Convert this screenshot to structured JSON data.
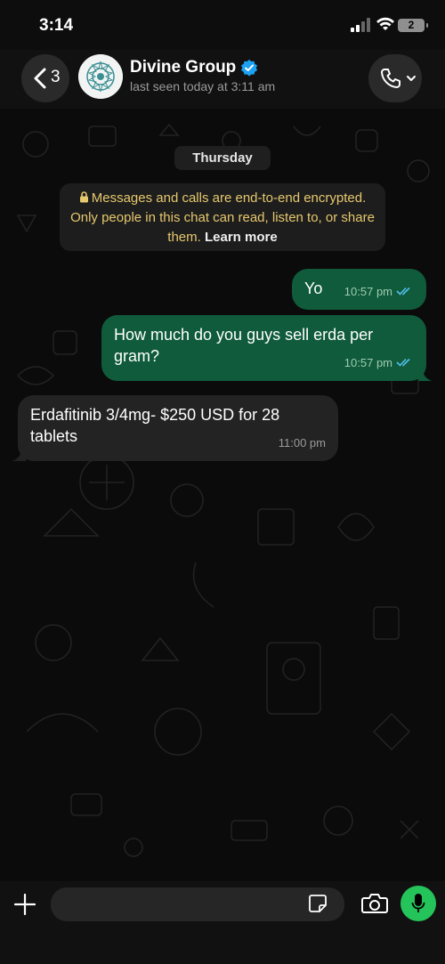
{
  "status_bar": {
    "time": "3:14",
    "battery_level": "2"
  },
  "header": {
    "back_count": "3",
    "contact_name": "Divine Group",
    "last_seen": "last seen today at 3:11 am"
  },
  "chat": {
    "day_label": "Thursday",
    "encryption_notice": "Messages and calls are end-to-end encrypted. Only people in this chat can read, listen to, or share them.",
    "learn_more": "Learn more",
    "messages": [
      {
        "direction": "outgoing",
        "text": "Yo",
        "time": "10:57 pm",
        "status": "read"
      },
      {
        "direction": "outgoing",
        "text": "How much do you guys sell erda per gram?",
        "time": "10:57 pm",
        "status": "read"
      },
      {
        "direction": "incoming",
        "text": "Erdafitinib 3/4mg- $250 USD for 28 tablets",
        "time": "11:00 pm"
      }
    ]
  },
  "composer": {
    "input_value": "",
    "input_placeholder": ""
  },
  "colors": {
    "outgoing_bubble": "#0f5b3b",
    "incoming_bubble": "#232323",
    "read_ticks": "#53bdeb",
    "mic_button": "#25c45a",
    "encryption_text": "#e6c86d"
  }
}
